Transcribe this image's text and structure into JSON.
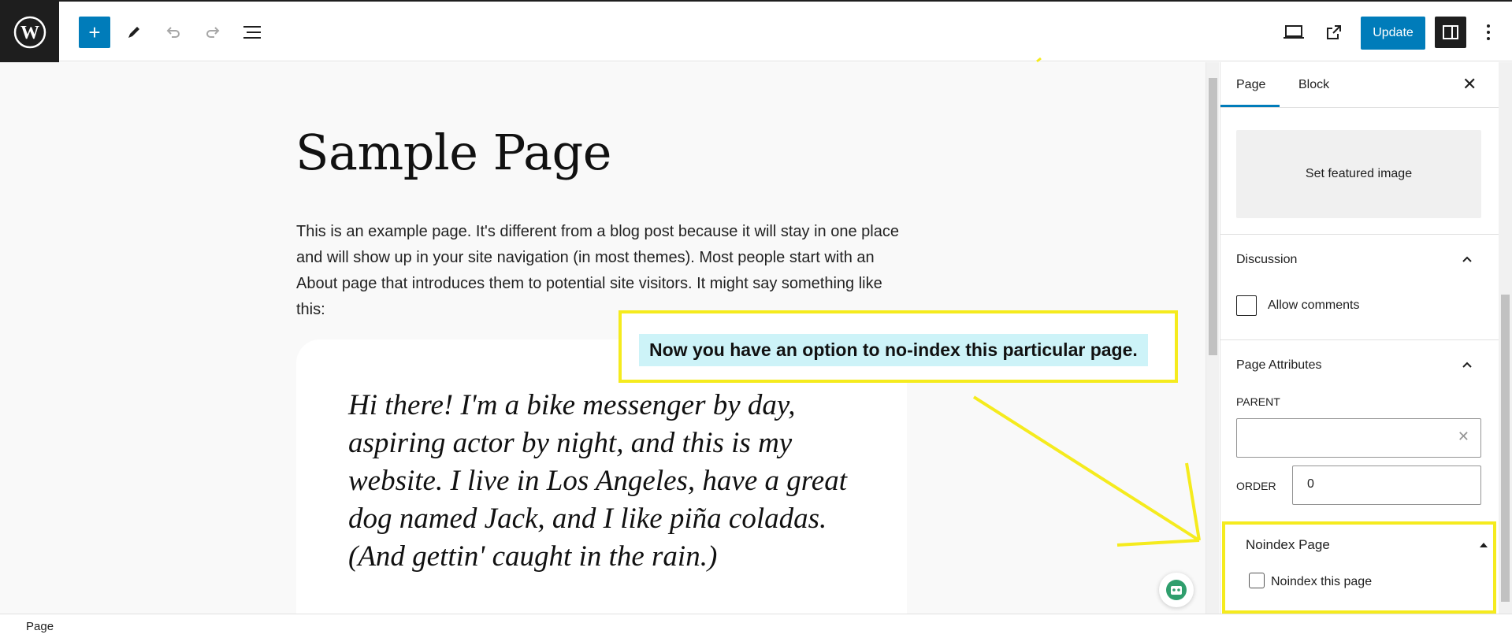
{
  "toolbar": {
    "add_label": "+",
    "update_label": "Update",
    "icons": [
      "wordpress-icon",
      "plus-icon",
      "pencil-icon",
      "undo-icon",
      "redo-icon",
      "list-view-icon",
      "desktop-preview-icon",
      "external-link-icon",
      "sidebar-toggle-icon",
      "more-options-icon"
    ]
  },
  "editor": {
    "title": "Sample Page",
    "intro": "This is an example page. It's different from a blog post because it will stay in one place and will show up in your site navigation (in most themes). Most people start with an About page that introduces them to potential site visitors. It might say something like this:",
    "quote": "Hi there! I'm a bike messenger by day, aspiring actor by night, and this is my website. I live in Los Angeles, have a great dog named Jack, and I like piña coladas. (And gettin' caught in the rain.)"
  },
  "annotation": {
    "text": "Now you have an option to no-index this particular page.",
    "color": "#f5eb1e"
  },
  "sidebar": {
    "tabs": [
      "Page",
      "Block"
    ],
    "featured_image": "Set featured image",
    "discussion": {
      "title": "Discussion",
      "allow_comments": "Allow comments"
    },
    "page_attributes": {
      "title": "Page Attributes",
      "parent_label": "PARENT",
      "order_label": "ORDER",
      "order_value": "0"
    },
    "noindex": {
      "title": "Noindex Page",
      "checkbox_label": "Noindex this page"
    }
  },
  "statusbar": {
    "text": "Page"
  },
  "colors": {
    "accent": "#007cba",
    "dark": "#1e1e1e",
    "highlight": "#f5eb1e"
  }
}
